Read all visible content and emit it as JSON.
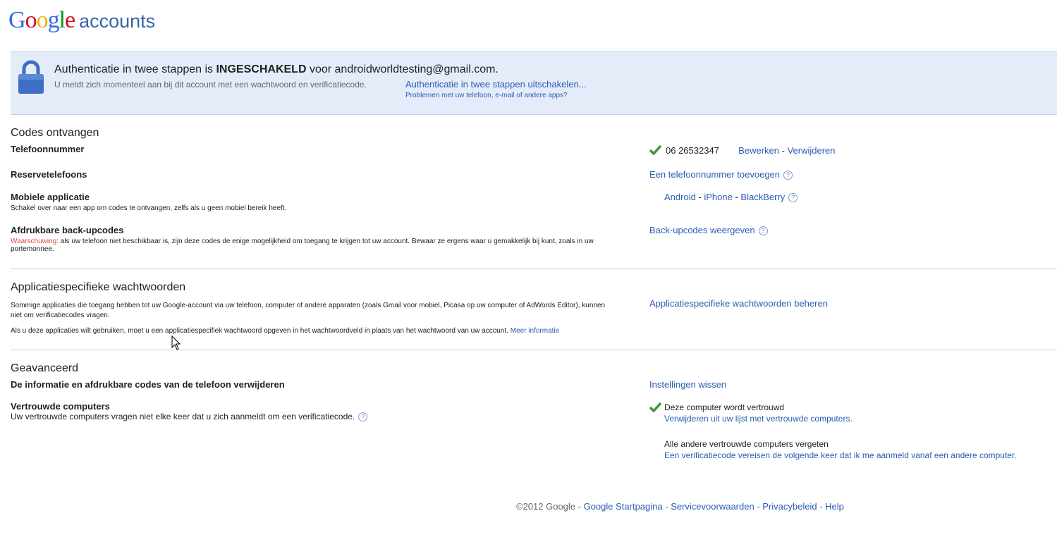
{
  "header": {
    "logo_google": "Google",
    "logo_product": "accounts"
  },
  "banner": {
    "title_prefix": "Authenticatie in twee stappen is ",
    "title_status": "INGESCHAKELD",
    "title_suffix": " voor androidworldtesting@gmail.com.",
    "description": "U meldt zich momenteel aan bij dit account met een wachtwoord en verificatiecode.",
    "disable_link": "Authenticatie in twee stappen uitschakelen...",
    "problems_link": "Problemen met uw telefoon, e-mail of andere apps?"
  },
  "codes": {
    "heading": "Codes ontvangen",
    "phone": {
      "label": "Telefoonnummer",
      "number": "06 26532347",
      "edit_link": "Bewerken",
      "remove_link": "Verwijderen"
    },
    "backup_phones": {
      "label": "Reservetelefoons",
      "add_link": "Een telefoonnummer toevoegen"
    },
    "mobile_app": {
      "label": "Mobiele applicatie",
      "description": "Schakel over naar een app om codes te ontvangen, zelfs als u geen mobiel bereik heeft.",
      "android_link": "Android",
      "iphone_link": "iPhone",
      "blackberry_link": "BlackBerry"
    },
    "backup_codes": {
      "label": "Afdrukbare back-upcodes",
      "warning_label": "Waarschuwing:",
      "warning_text": " als uw telefoon niet beschikbaar is, zijn deze codes de enige mogelijkheid om toegang te krijgen tot uw account. Bewaar ze ergens waar u gemakkelijk bij kunt, zoals in uw portemonnee.",
      "show_link": "Back-upcodes weergeven"
    }
  },
  "app_passwords": {
    "heading": "Applicatiespecifieke wachtwoorden",
    "paragraph1": "Sommige applicaties die toegang hebben tot uw Google-account via uw telefoon, computer of andere apparaten (zoals Gmail voor mobiel, Picasa op uw computer of AdWords Editor), kunnen niet om verificatiecodes vragen.",
    "paragraph2": "Als u deze applicaties wilt gebruiken, moet u een applicatiespecifiek wachtwoord opgeven in het wachtwoordveld in plaats van het wachtwoord van uw account. ",
    "more_info_link": "Meer informatie",
    "manage_link": "Applicatiespecifieke wachtwoorden beheren"
  },
  "advanced": {
    "heading": "Geavanceerd",
    "remove_phone_label": "De informatie en afdrukbare codes van de telefoon verwijderen",
    "reset_link": "Instellingen wissen",
    "trusted": {
      "label": "Vertrouwde computers",
      "description": "Uw vertrouwde computers vragen niet elke keer dat u zich aanmeldt om een verificatiecode.",
      "status": "Deze computer wordt vertrouwd",
      "remove_link": "Verwijderen uit uw lijst met vertrouwde computers.",
      "forget_label": "Alle andere vertrouwde computers vergeten",
      "forget_link": "Een verificatiecode vereisen de volgende keer dat ik me aanmeld vanaf een andere computer."
    }
  },
  "footer": {
    "copyright": "©2012 Google",
    "home_link": "Google Startpagina",
    "terms_link": "Servicevoorwaarden",
    "privacy_link": "Privacybeleid",
    "help_link": "Help"
  },
  "colors": {
    "link": "#2a5db0",
    "banner_bg": "#e5ecf9",
    "check": "#3a9a3a",
    "warning": "#dd4b39"
  }
}
